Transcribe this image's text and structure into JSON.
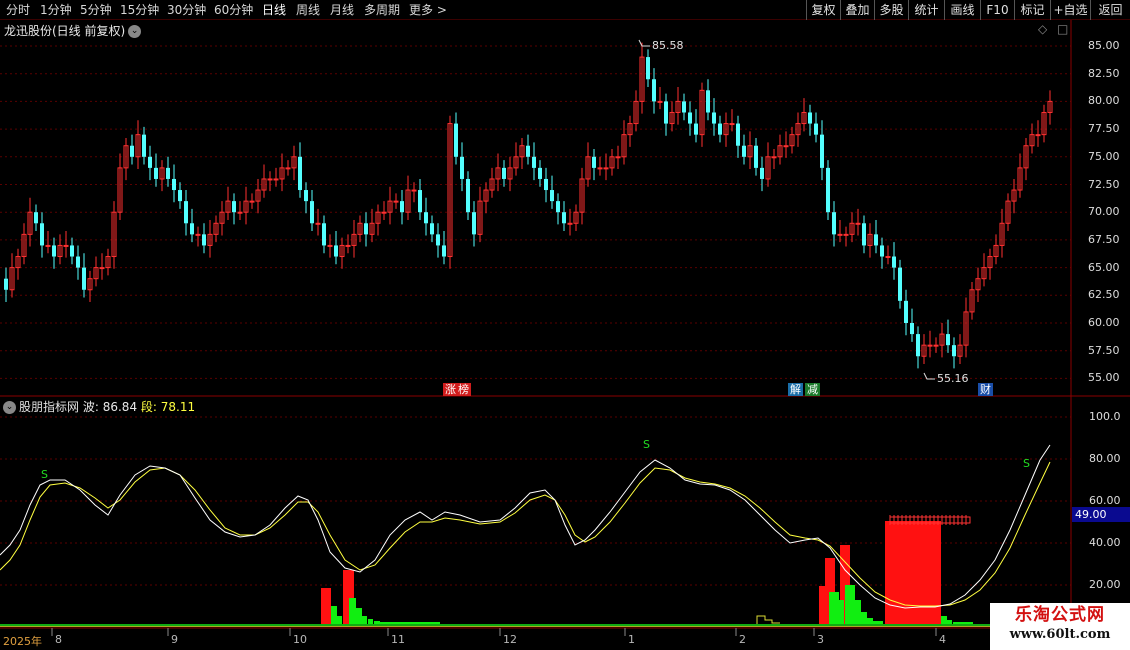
{
  "toolbar": {
    "periods": [
      "分时",
      "1分钟",
      "5分钟",
      "15分钟",
      "30分钟",
      "60分钟",
      "日线",
      "周线",
      "月线",
      "多周期",
      "更多"
    ],
    "more_arrow": ">",
    "buttons": [
      "复权",
      "叠加",
      "多股",
      "统计",
      "画线",
      "F10",
      "标记",
      "+自选",
      "返回"
    ]
  },
  "main_chart": {
    "title": "龙迅股份(日线 前复权)",
    "chevron": "⌄",
    "diamond": "◇",
    "side_glyph": "□",
    "high_label": "85.58",
    "low_label": "55.16",
    "y_ticks": [
      "85.00",
      "82.50",
      "80.00",
      "77.50",
      "75.00",
      "72.50",
      "70.00",
      "67.50",
      "65.00",
      "62.50",
      "60.00",
      "57.50",
      "55.00"
    ],
    "event_markers": [
      {
        "text": "涨",
        "bg": "#d11d1d",
        "fg": "#ffffff"
      },
      {
        "text": "榜",
        "bg": "#d11d1d",
        "fg": "#ffffff"
      },
      {
        "text": "解",
        "bg": "#1a6ea8",
        "fg": "#ffffff"
      },
      {
        "text": "减",
        "bg": "#1a7a2a",
        "fg": "#ffffff"
      },
      {
        "text": "财",
        "bg": "#1a4ea8",
        "fg": "#ffffff"
      }
    ],
    "colors": {
      "up": "#ff3030",
      "down": "#54ffff",
      "grid": "#6b0000"
    }
  },
  "indicator": {
    "name": "股朋指标网",
    "wave_label": "波:",
    "wave_value": "86.84",
    "seg_label": "段:",
    "seg_value": "78.11",
    "y_ticks": [
      "100.0",
      "80.00",
      "60.00",
      "40.00",
      "20.00"
    ],
    "current_value": "49.00",
    "s_markers": [
      "S",
      "S",
      "S"
    ],
    "colors": {
      "wave": "#ffffff",
      "seg": "#ffff40",
      "red_bar": "#ff1111",
      "green_bar": "#11ee11"
    }
  },
  "date_axis": [
    "2025年",
    "8",
    "9",
    "10",
    "11",
    "12",
    "1",
    "2",
    "3",
    "4"
  ],
  "watermark": {
    "line1": "乐淘公式网",
    "line2": "www.60lt.com"
  }
}
